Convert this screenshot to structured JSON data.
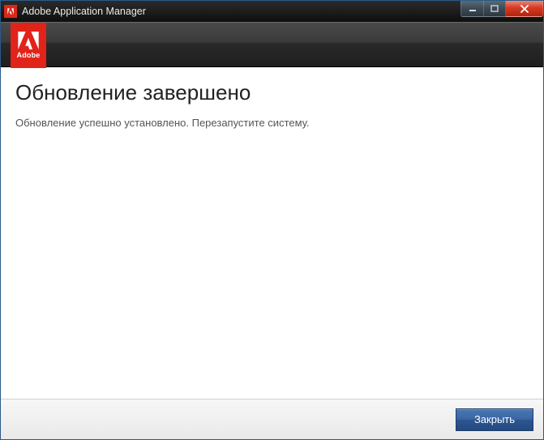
{
  "titlebar": {
    "title": "Adobe Application Manager"
  },
  "badge": {
    "word": "Adobe"
  },
  "content": {
    "heading": "Обновление завершено",
    "body": "Обновление успешно установлено. Перезапустите систему."
  },
  "footer": {
    "close_label": "Закрыть"
  }
}
